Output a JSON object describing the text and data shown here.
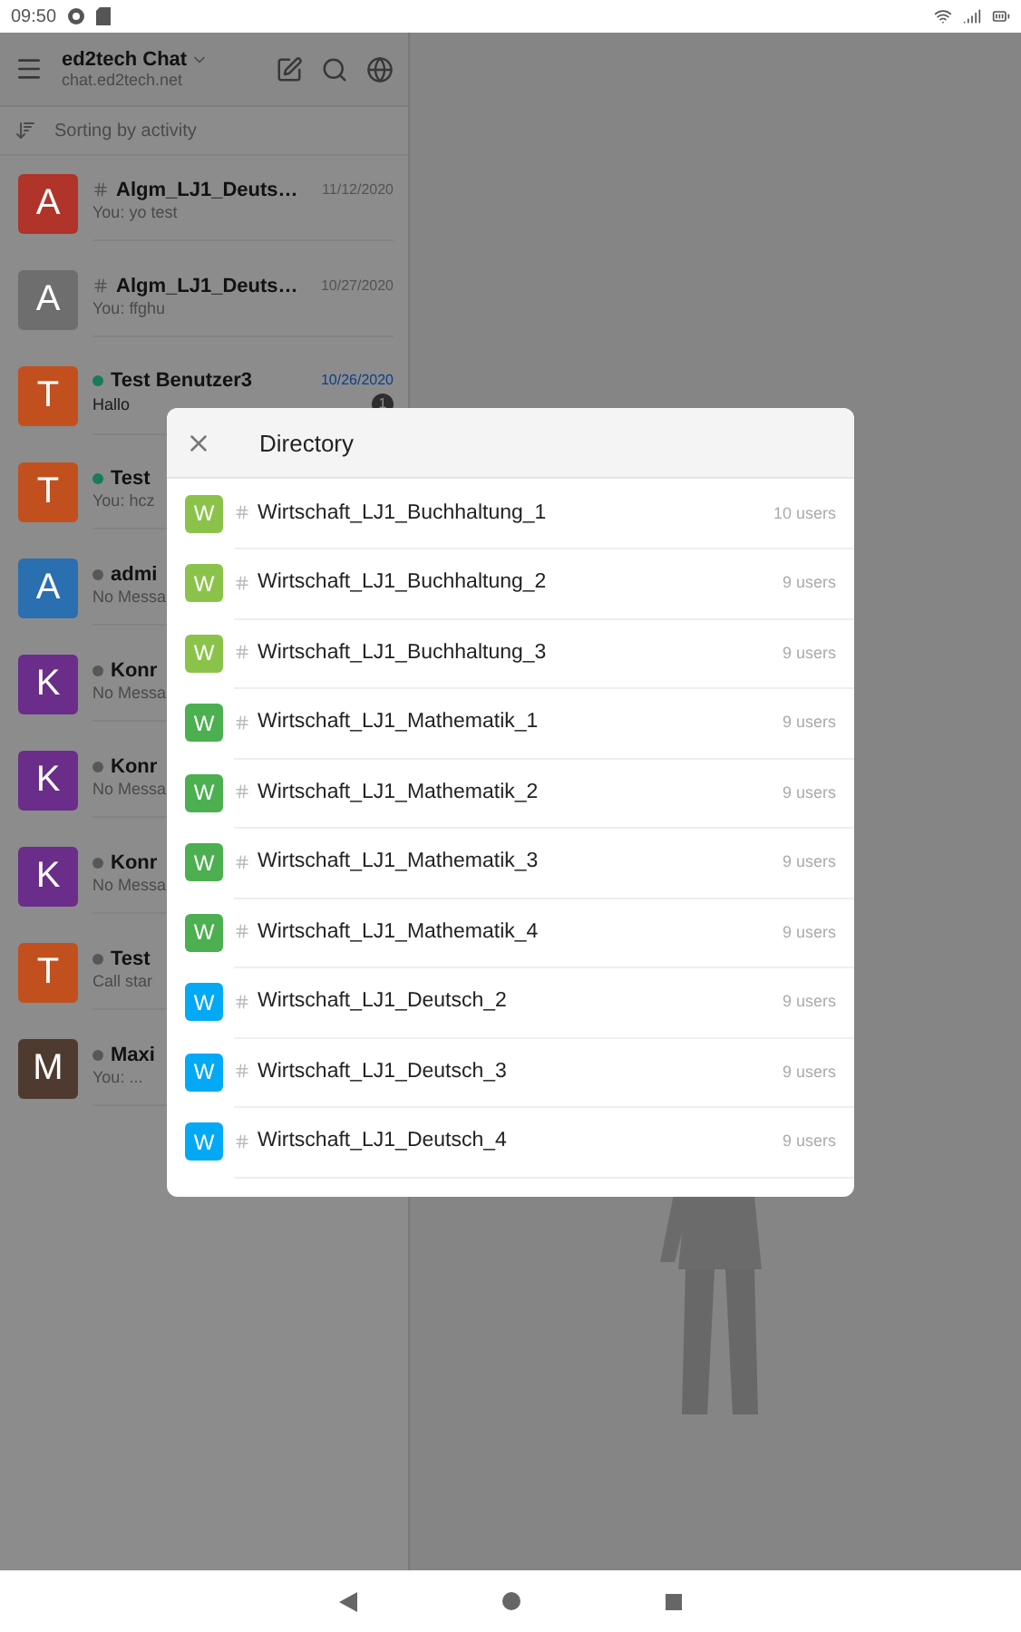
{
  "status_bar": {
    "time": "09:50"
  },
  "header": {
    "title": "ed2tech Chat",
    "subtitle": "chat.ed2tech.net"
  },
  "sort_bar": {
    "label": "Sorting by activity"
  },
  "chats": [
    {
      "kind": "channel",
      "avatar": "A",
      "color": "#b0342a",
      "name": "Algm_LJ1_Deuts…",
      "date": "11/12/2020",
      "preview": "You: yo test",
      "unread": false
    },
    {
      "kind": "channel",
      "avatar": "A",
      "color": "#6e6e6e",
      "name": "Algm_LJ1_Deuts…",
      "date": "10/27/2020",
      "preview": "You: ffghu",
      "unread": false
    },
    {
      "kind": "user",
      "online": true,
      "avatar": "T",
      "color": "#c2501f",
      "name": "Test Benutzer3",
      "date": "10/26/2020",
      "preview": "Hallo",
      "unread": true,
      "badge": "1"
    },
    {
      "kind": "user",
      "online": true,
      "avatar": "T",
      "color": "#c2501f",
      "name": "Test",
      "preview": "You: hcz"
    },
    {
      "kind": "user",
      "online": false,
      "avatar": "A",
      "color": "#2a6fb0",
      "name": "admi",
      "preview": "No Messa"
    },
    {
      "kind": "user",
      "online": false,
      "avatar": "K",
      "color": "#6a2d8a",
      "name": "Konr",
      "preview": "No Messa"
    },
    {
      "kind": "user",
      "online": false,
      "avatar": "K",
      "color": "#6a2d8a",
      "name": "Konr",
      "preview": "No Messa"
    },
    {
      "kind": "user",
      "online": false,
      "avatar": "K",
      "color": "#6a2d8a",
      "name": "Konr",
      "preview": "No Messa"
    },
    {
      "kind": "user",
      "online": false,
      "avatar": "T",
      "color": "#c2501f",
      "name": "Test",
      "preview": "Call star"
    },
    {
      "kind": "user",
      "online": false,
      "avatar": "M",
      "color": "#4f3a30",
      "name": "Maxi",
      "preview": "You: ..."
    }
  ],
  "directory": {
    "title": "Directory",
    "rows": [
      {
        "avatar": "W",
        "color": "#8bc34a",
        "name": "Wirtschaft_LJ1_Buchhaltung_1",
        "users": "10 users"
      },
      {
        "avatar": "W",
        "color": "#8bc34a",
        "name": "Wirtschaft_LJ1_Buchhaltung_2",
        "users": "9 users"
      },
      {
        "avatar": "W",
        "color": "#8bc34a",
        "name": "Wirtschaft_LJ1_Buchhaltung_3",
        "users": "9 users"
      },
      {
        "avatar": "W",
        "color": "#4caf50",
        "name": "Wirtschaft_LJ1_Mathematik_1",
        "users": "9 users"
      },
      {
        "avatar": "W",
        "color": "#4caf50",
        "name": "Wirtschaft_LJ1_Mathematik_2",
        "users": "9 users"
      },
      {
        "avatar": "W",
        "color": "#4caf50",
        "name": "Wirtschaft_LJ1_Mathematik_3",
        "users": "9 users"
      },
      {
        "avatar": "W",
        "color": "#4caf50",
        "name": "Wirtschaft_LJ1_Mathematik_4",
        "users": "9 users"
      },
      {
        "avatar": "W",
        "color": "#03a9f4",
        "name": "Wirtschaft_LJ1_Deutsch_2",
        "users": "9 users"
      },
      {
        "avatar": "W",
        "color": "#03a9f4",
        "name": "Wirtschaft_LJ1_Deutsch_3",
        "users": "9 users"
      },
      {
        "avatar": "W",
        "color": "#03a9f4",
        "name": "Wirtschaft_LJ1_Deutsch_4",
        "users": "9 users"
      }
    ]
  }
}
